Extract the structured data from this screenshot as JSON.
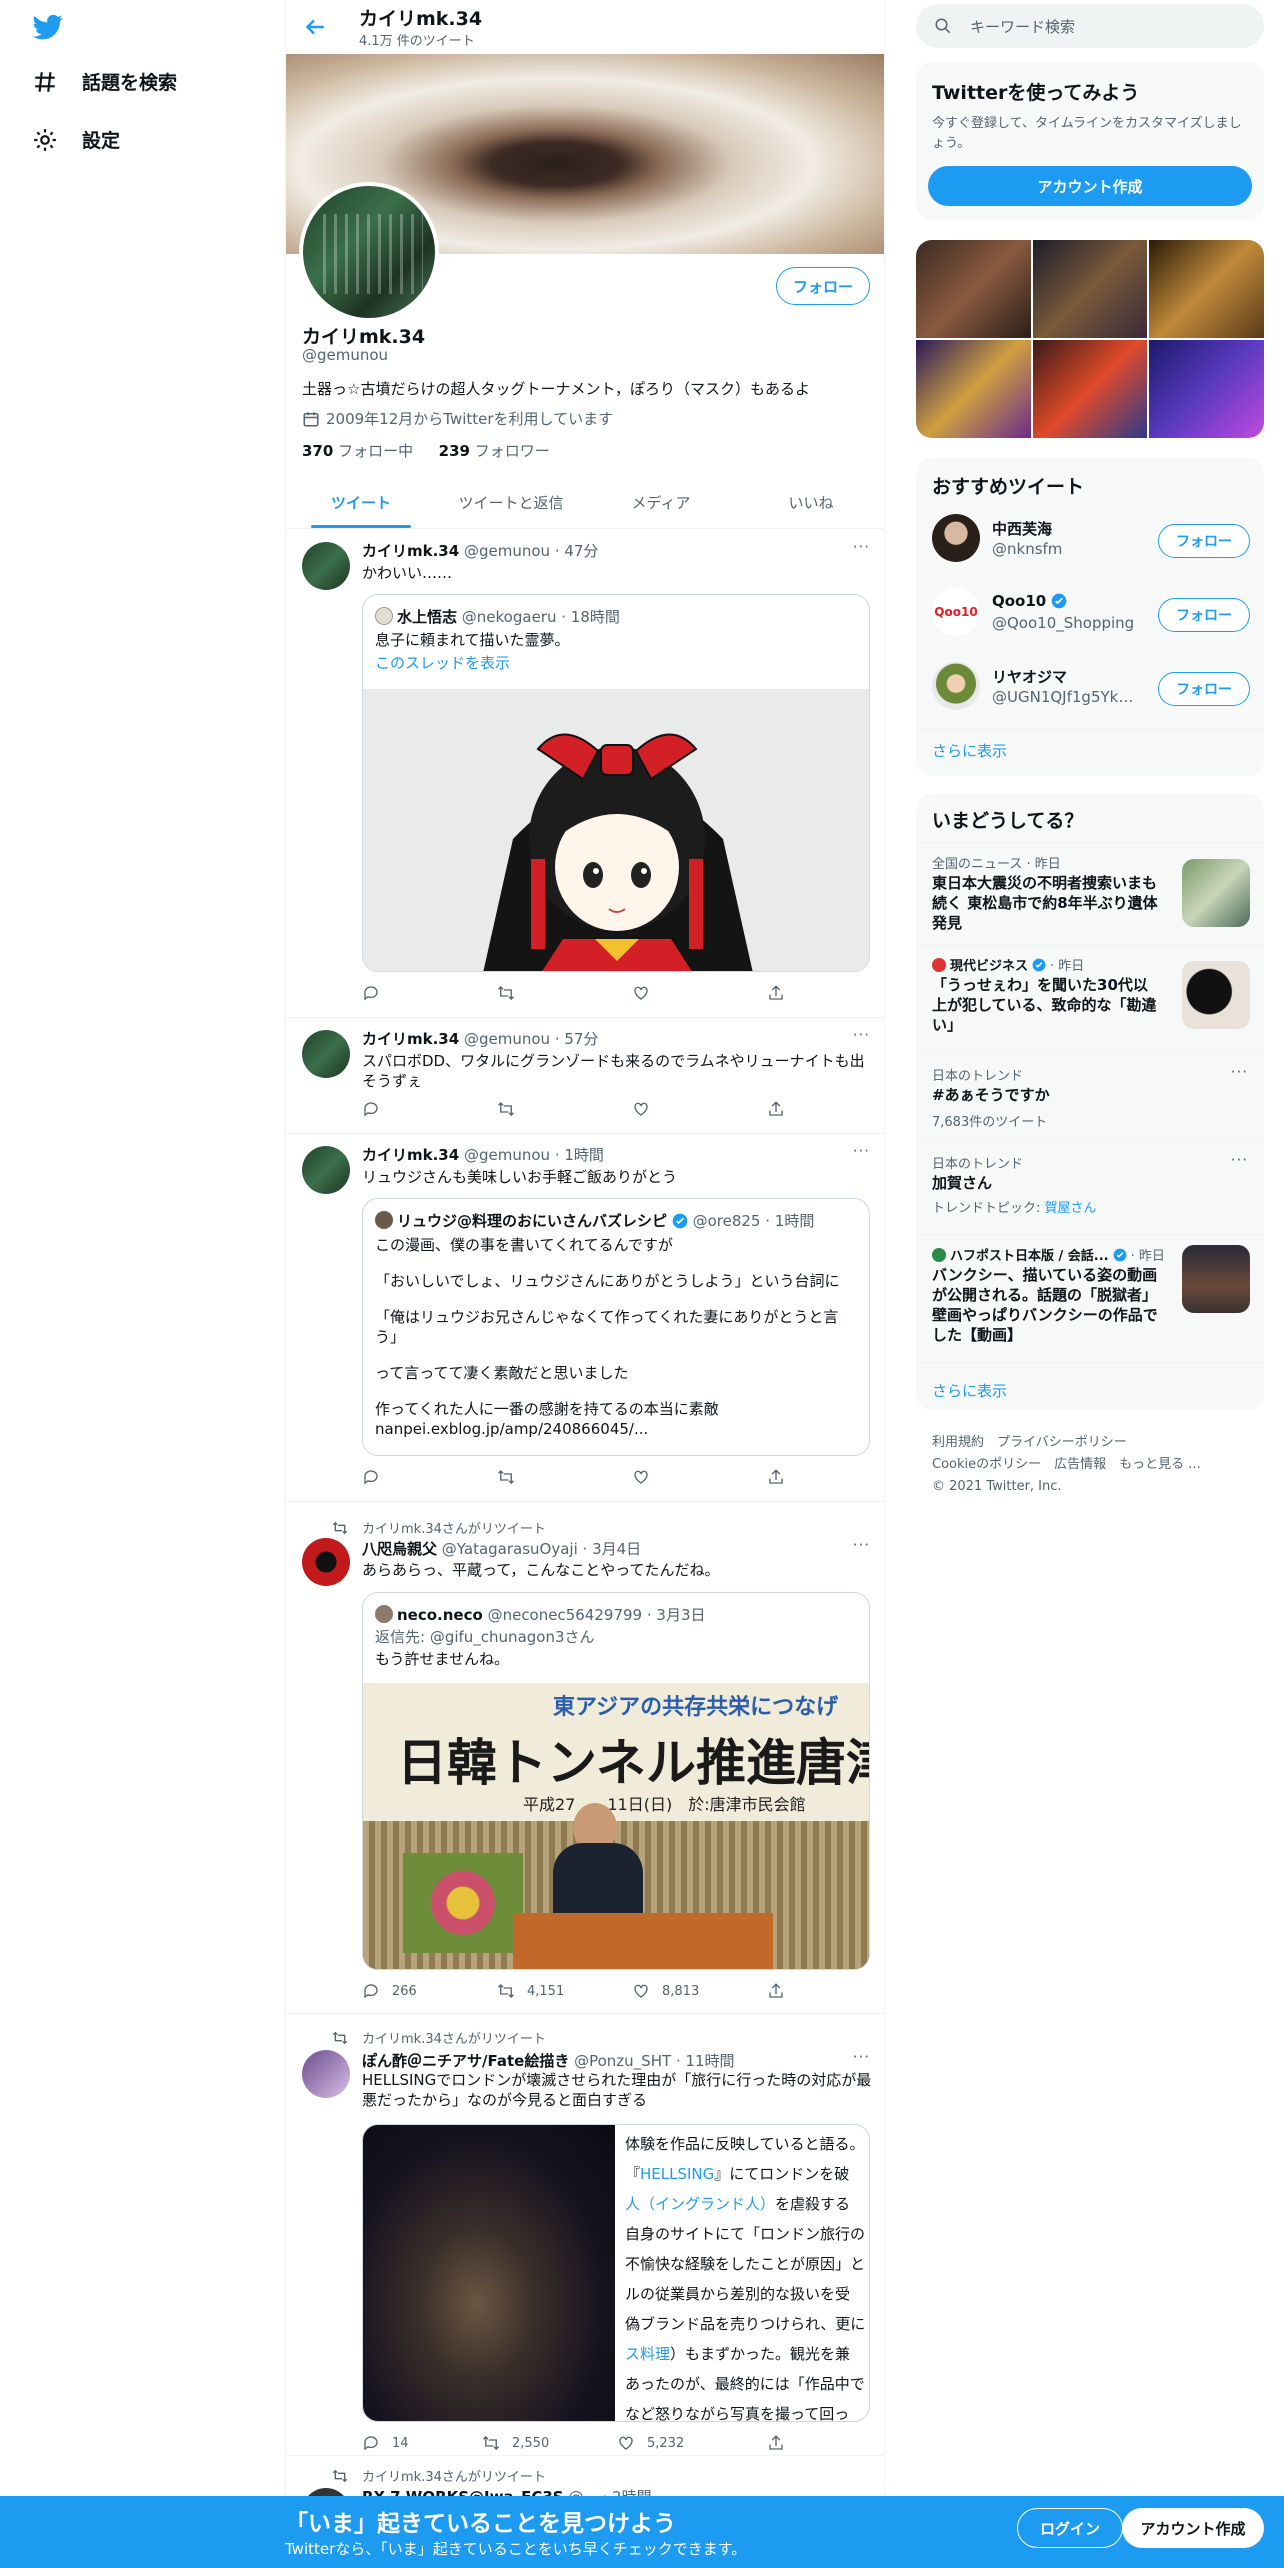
{
  "nav": {
    "explore": "話題を検索",
    "settings": "設定"
  },
  "profile": {
    "name": "カイリmk.34",
    "tweet_count": "4.1万 件のツイート",
    "handle": "@gemunou",
    "bio": "土器っ☆古墳だらけの超人タッグトーナメント，ぽろり（マスク）もあるよ",
    "joined": "2009年12月からTwitterを利用しています",
    "following_count": "370",
    "following_label": "フォロー中",
    "followers_count": "239",
    "followers_label": "フォロワー",
    "follow_button": "フォロー"
  },
  "tabs": [
    "ツイート",
    "ツイートと返信",
    "メディア",
    "いいね"
  ],
  "tweets": [
    {
      "name": "カイリmk.34",
      "handle": "@gemunou",
      "time": "· 47分",
      "text": "かわいい……",
      "quote": {
        "name": "水上悟志",
        "handle": "@nekogaeru",
        "time": "· 18時間",
        "text": "息子に頼まれて描いた霊夢。",
        "link": "このスレッドを表示"
      }
    },
    {
      "name": "カイリmk.34",
      "handle": "@gemunou",
      "time": "· 57分",
      "text": "スパロボDD、ワタルにグランゾードも来るのでラムネやリューナイトも出そうずぇ"
    },
    {
      "name": "カイリmk.34",
      "handle": "@gemunou",
      "time": "· 1時間",
      "text": "リュウジさんも美味しいお手軽ご飯ありがとう",
      "quote": {
        "name": "リュウジ@料理のおにいさんバズレシピ",
        "handle": "@ore825",
        "time": "· 1時間",
        "lines": [
          "この漫画、僕の事を書いてくれてるんですが",
          "「おいしいでしょ、リュウジさんにありがとうしよう」という台詞に",
          "「俺はリュウジお兄さんじゃなくて作ってくれた妻にありがとうと言う」",
          "って言ってて凄く素敵だと思いました",
          "作ってくれた人に一番の感謝を持てるの本当に素敵",
          "nanpei.exblog.jp/amp/240866045/..."
        ]
      }
    },
    {
      "retweet_label": "カイリmk.34さんがリツイート",
      "name": "八咫烏親父",
      "handle": "@YatagarasuOyaji",
      "time": "· 3月4日",
      "text": "あらあらっ、平蔵って，こんなことやってたんだね。",
      "quote": {
        "name": "neco.neco",
        "handle": "@neconec56429799",
        "time": "· 3月3日",
        "reply_to": "返信先: @gifu_chunagon3さん",
        "text": "もう許せませんね。",
        "image_banner": "東アジアの共存共栄につなげ",
        "image_title": "日韓トンネル推進唐津",
        "image_sub": "平成27　　11日(日)　於:唐津市民会館"
      },
      "reply": "266",
      "retweets": "4,151",
      "likes": "8,813"
    },
    {
      "retweet_label": "カイリmk.34さんがリツイート",
      "name": "ぽん酢＠ニチアサ/Fate絵描き",
      "handle": "@Ponzu_SHT",
      "time": "· 11時間",
      "text": "HELLSINGでロンドンが壊滅させられた理由が「旅行に行った時の対応が最悪だったから」なのが今見ると面白すぎる",
      "side_text": [
        {
          "t": "体験を作品に反映していると語る。"
        },
        {
          "t": "『",
          "b": "HELLSING",
          "a": "』にてロンドンを破"
        },
        {
          "t": "",
          "b": "人（イングランド人）",
          "a": "を虐殺する"
        },
        {
          "t": "自身のサイトにて「ロンドン旅行の"
        },
        {
          "t": "不愉快な経験をしたことが原因」と"
        },
        {
          "t": "ルの従業員から差別的な扱いを受"
        },
        {
          "t": "偽ブランド品を売りつけられ、更に"
        },
        {
          "t": "",
          "b": "ス料理",
          "a": "）もまずかった。観光を兼"
        },
        {
          "t": "あったのが、最終的には「作品中で"
        },
        {
          "t": "など怒りながら写真を撮って回っ"
        }
      ],
      "reply": "14",
      "retweets": "2,550",
      "likes": "5,232"
    },
    {
      "retweet_label": "カイリmk.34さんがリツイート",
      "name": "RX-7 WORKS@Iwa_FC3S",
      "handle": "@...",
      "time": "· 2時間"
    }
  ],
  "search": {
    "placeholder": "キーワード検索"
  },
  "signup_card": {
    "title": "Twitterを使ってみよう",
    "text": "今すぐ登録して、タイムラインをカスタマイズしましょう。",
    "button": "アカウント作成"
  },
  "recommended": {
    "title": "おすすめツイート",
    "users": [
      {
        "name": "中西芙海",
        "handle": "@nknsfm",
        "button": "フォロー"
      },
      {
        "name": "Qoo10",
        "handle": "@Qoo10_Shopping",
        "button": "フォロー",
        "logo": "Qoo10"
      },
      {
        "name": "リヤオジマ",
        "handle": "@UGN1QJf1g5YkX...",
        "button": "フォロー"
      }
    ],
    "more": "さらに表示"
  },
  "trends": {
    "title": "いまどうしてる？",
    "items": [
      {
        "meta": "全国のニュース · 昨日",
        "title": "東日本大震災の不明者捜索いまも続く 東松島市で約8年半ぶり遺体発見"
      },
      {
        "meta": "現代ビジネス",
        "meta_after": "· 昨日",
        "title": "「うっせぇわ」を聞いた30代以上が犯している、致命的な「勘違い」"
      },
      {
        "meta": "日本のトレンド",
        "title": "#あぁそうですか",
        "sub": "7,683件のツイート"
      },
      {
        "meta": "日本のトレンド",
        "title": "加賀さん",
        "sub": "トレンドトピック:",
        "sub_link": "賀屋さん"
      },
      {
        "meta": "ハフポスト日本版 / 会話...",
        "meta_after": "· 昨日",
        "title": "バンクシー、描いている姿の動画が公開される。話題の「脱獄者」壁画やっぱりバンクシーの作品でした【動画】"
      }
    ],
    "more": "さらに表示"
  },
  "footer": {
    "links1": [
      "利用規約",
      "プライバシーポリシー"
    ],
    "links2": [
      "Cookieのポリシー",
      "広告情報",
      "もっと見る ..."
    ],
    "copyright": "© 2021 Twitter, Inc."
  },
  "bottom_bar": {
    "title": "「いま」起きていることを見つけよう",
    "subtitle": "Twitterなら、「いま」起きていることをいち早くチェックできます。",
    "login": "ログイン",
    "signup": "アカウント作成"
  }
}
